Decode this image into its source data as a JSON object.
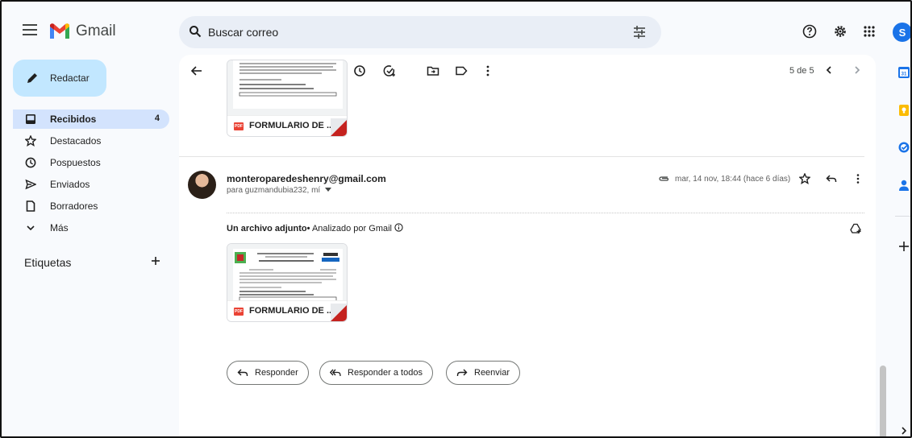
{
  "app": {
    "name": "Gmail"
  },
  "search": {
    "placeholder": "Buscar correo"
  },
  "compose": {
    "label": "Redactar"
  },
  "sidebar": {
    "items": [
      {
        "label": "Recibidos",
        "count": "4",
        "icon": "inbox-icon",
        "active": true
      },
      {
        "label": "Destacados",
        "icon": "star-icon"
      },
      {
        "label": "Pospuestos",
        "icon": "clock-icon"
      },
      {
        "label": "Enviados",
        "icon": "send-icon"
      },
      {
        "label": "Borradores",
        "icon": "draft-icon"
      },
      {
        "label": "Más",
        "icon": "chevron-down-icon"
      }
    ],
    "labels_heading": "Etiquetas"
  },
  "header": {
    "avatar_letter": "S"
  },
  "toolbar": {
    "pager": "5 de 5"
  },
  "previous_attachment": {
    "filename": "FORMULARIO DE ..."
  },
  "message": {
    "sender": "monteroparedeshenry@gmail.com",
    "recipients": "para guzmandubia232, mí",
    "date": "mar, 14 nov, 18:44 (hace 6 días)",
    "attachment_heading": "Un archivo adjunto",
    "scanned_note": "Analizado por Gmail",
    "attachment": {
      "filename": "FORMULARIO DE ..."
    }
  },
  "actions": {
    "reply": "Responder",
    "reply_all": "Responder a todos",
    "forward": "Reenviar"
  },
  "colors": {
    "compose_bg": "#c2e7ff",
    "active_nav_bg": "#d3e3fd",
    "search_bg": "#e9eef6",
    "avatar_bg": "#1a73e8",
    "pdf_red": "#ea4335"
  }
}
